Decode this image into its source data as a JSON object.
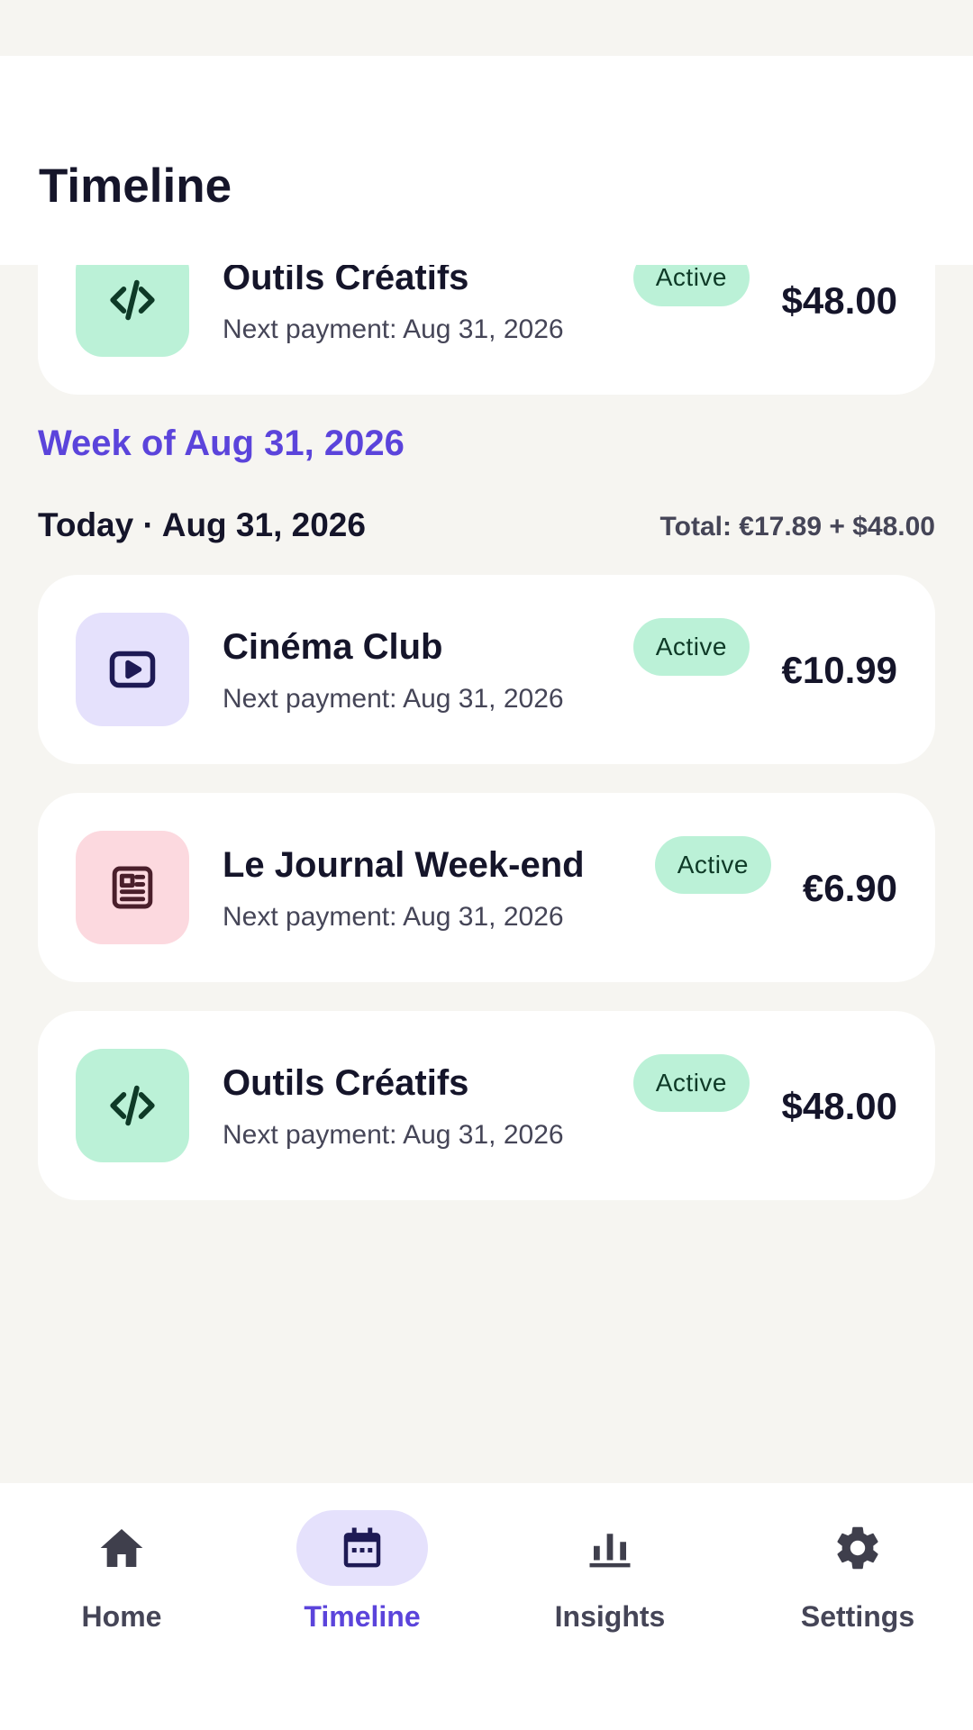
{
  "header": {
    "title": "Timeline"
  },
  "top_card": {
    "name": "Outils Créatifs",
    "next_payment": "Next payment: Aug 31, 2026",
    "status": "Active",
    "amount": "$48.00",
    "icon": "code-icon"
  },
  "week_heading": "Week of Aug 31, 2026",
  "day": {
    "label": "Today · Aug 31, 2026",
    "total": "Total: €17.89 + $48.00"
  },
  "subscriptions": [
    {
      "name": "Cinéma Club",
      "next_payment": "Next payment: Aug 31, 2026",
      "status": "Active",
      "amount": "€10.99",
      "icon": "play-icon"
    },
    {
      "name": "Le Journal Week-end",
      "next_payment": "Next payment: Aug 31, 2026",
      "status": "Active",
      "amount": "€6.90",
      "icon": "newspaper-icon"
    },
    {
      "name": "Outils Créatifs",
      "next_payment": "Next payment: Aug 31, 2026",
      "status": "Active",
      "amount": "$48.00",
      "icon": "code-icon"
    }
  ],
  "nav": {
    "items": [
      {
        "label": "Home",
        "icon": "home-icon"
      },
      {
        "label": "Timeline",
        "icon": "calendar-icon",
        "active": true
      },
      {
        "label": "Insights",
        "icon": "bar-chart-icon"
      },
      {
        "label": "Settings",
        "icon": "gear-icon"
      }
    ]
  },
  "colors": {
    "accent": "#5B44DB",
    "badge_bg": "#BBF1D7",
    "background": "#F6F5F1"
  }
}
